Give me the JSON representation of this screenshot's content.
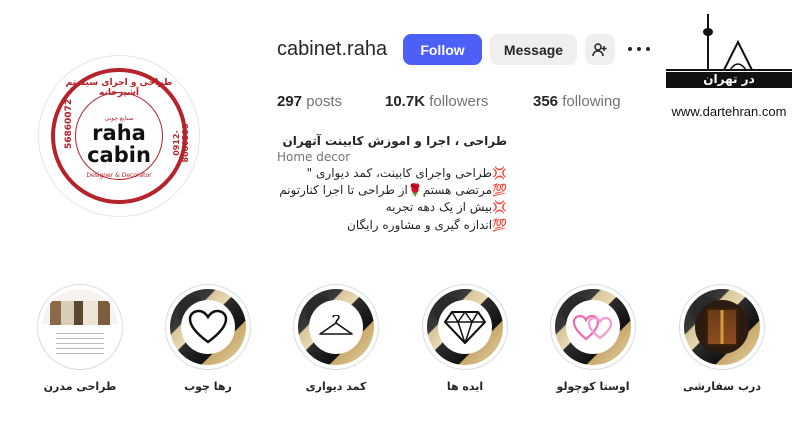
{
  "profile": {
    "username": "cabinet.raha",
    "follow_label": "Follow",
    "message_label": "Message",
    "stats": {
      "posts_count": "297",
      "posts_label": "posts",
      "followers_count": "10.7K",
      "followers_label": "followers",
      "following_count": "356",
      "following_label": "following"
    },
    "bio": {
      "name": "طراحی ، اجرا و اموزش کابینت آتهران",
      "category": "Home decor",
      "line1": "💢طراحی واجرای کابینت، کمد دیواری \"",
      "line2": "💯مرتضی هستم🌹از طراحی تا اجرا کنارتونم",
      "line3": "💢بیش از یک دهه تجربه",
      "line4": "💯اندازه گیری و مشاوره رایگان"
    }
  },
  "logo": {
    "top_text": "طراحی و اجرای سیستم آشپزخانه",
    "sub_text": "صنایع چوبی",
    "word1": "raha",
    "word2": "cabin",
    "tagline": "Designer & Decorator",
    "phone1": "56860072",
    "phone2": "0912- 8080398"
  },
  "watermark": {
    "text_fa": "در تهران",
    "url": "www.dartehran.com"
  },
  "highlights": [
    {
      "label": "طراحی مدرن",
      "icon": "photo"
    },
    {
      "label": "رها چوب",
      "icon": "heart-icon"
    },
    {
      "label": "کمد دیواری",
      "icon": "hanger-icon"
    },
    {
      "label": "ایده ها",
      "icon": "diamond-icon"
    },
    {
      "label": "اوستا کوچولو",
      "icon": "neon-hearts-icon"
    },
    {
      "label": "درب سفارشی",
      "icon": "door-photo"
    }
  ],
  "colors": {
    "follow_button": "#4c5ff7",
    "logo_red": "#b5232b"
  }
}
